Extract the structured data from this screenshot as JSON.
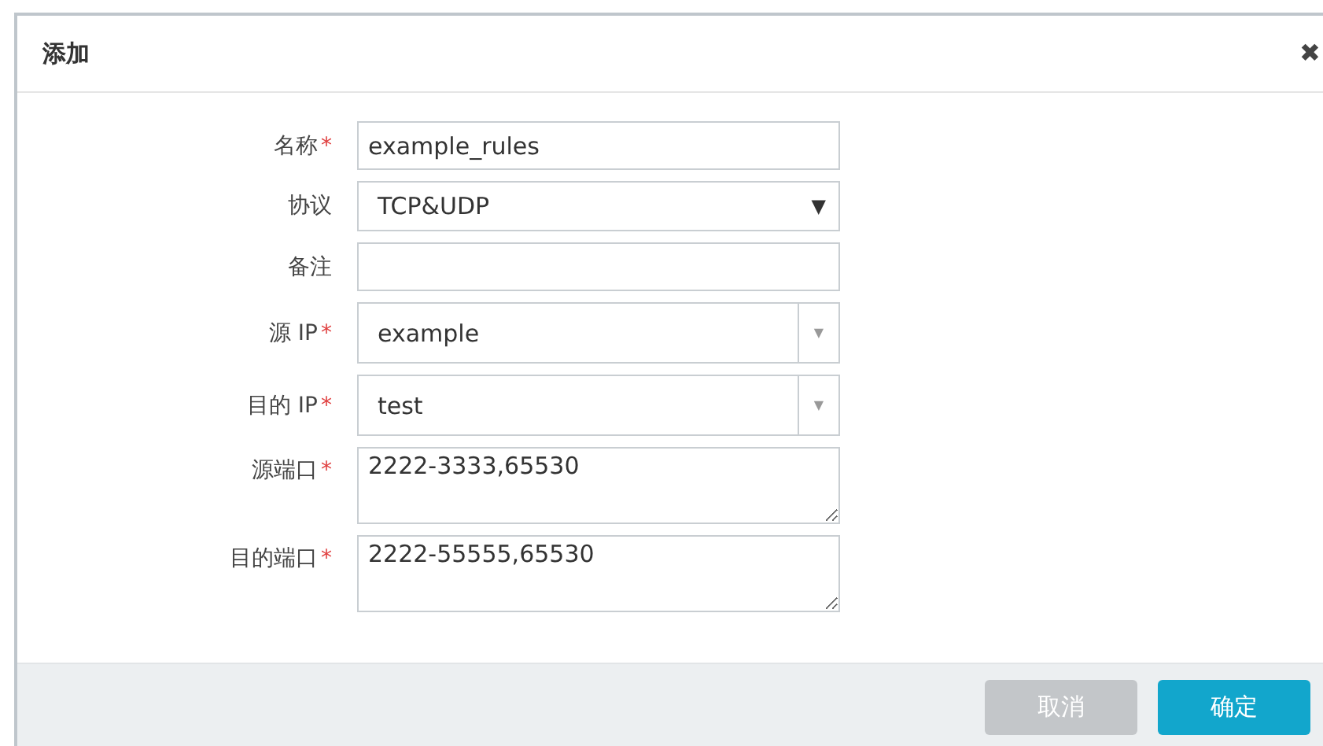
{
  "dialog": {
    "title": "添加",
    "close": "✖"
  },
  "fields": [
    {
      "label": "名称",
      "required": true,
      "kind": "text",
      "value": "example_rules"
    },
    {
      "label": "协议",
      "required": false,
      "kind": "select",
      "value": "TCP&UDP",
      "caret": "▼"
    },
    {
      "label": "备注",
      "required": false,
      "kind": "text"
    },
    {
      "label": "源 IP",
      "required": true,
      "kind": "combo",
      "value": "example",
      "caret": "▼"
    },
    {
      "label": "目的 IP",
      "required": true,
      "kind": "combo",
      "value": "test",
      "caret": "▼"
    },
    {
      "label": "源端口",
      "required": true,
      "kind": "textarea",
      "value": "2222-3333,65530"
    },
    {
      "label": "目的端口",
      "required": true,
      "kind": "textarea",
      "value": "2222-55555,65530"
    }
  ],
  "required_mark": "*",
  "buttons": [
    {
      "label": "取消",
      "kind": "cancel"
    },
    {
      "label": "确定",
      "kind": "primary"
    }
  ]
}
